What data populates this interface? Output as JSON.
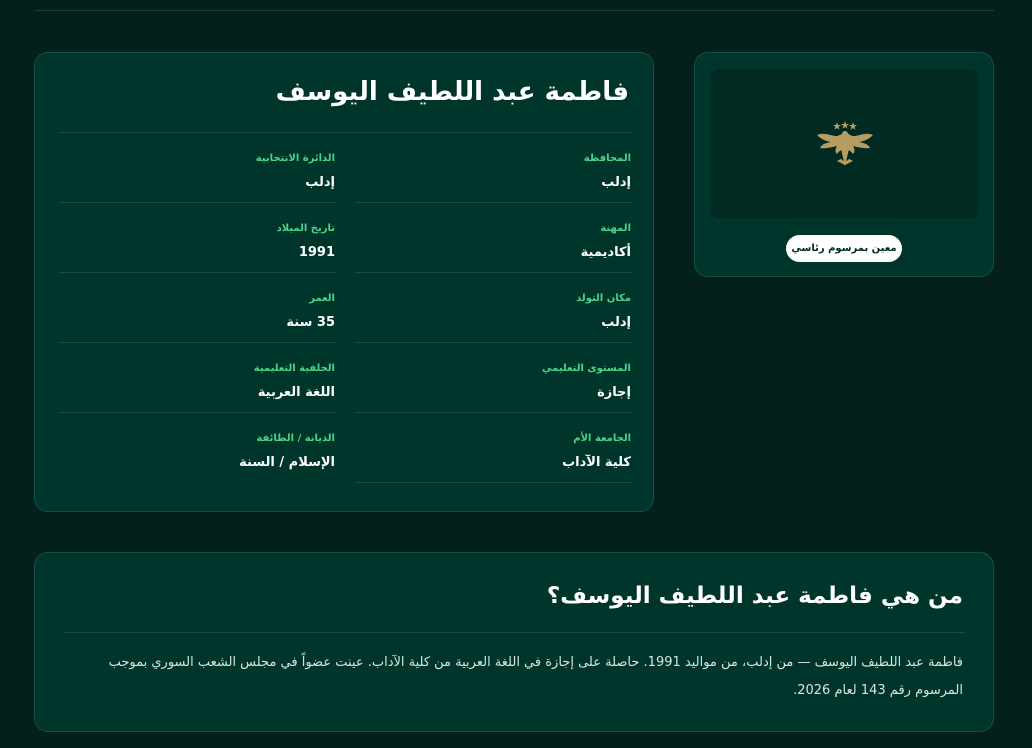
{
  "profile": {
    "name": "فاطمة عبد اللطيف اليوسف",
    "appointment_badge": "معين بمرسوم رئاسي",
    "photo_icon": "eagle-emblem-icon"
  },
  "fields": [
    {
      "label": "المحافظة",
      "value": "إدلب"
    },
    {
      "label": "الدائرة الانتخابية",
      "value": "إدلب"
    },
    {
      "label": "المهنة",
      "value": "أكاديمية"
    },
    {
      "label": "تاريخ الميلاد",
      "value": "1991"
    },
    {
      "label": "مكان التولد",
      "value": "إدلب"
    },
    {
      "label": "العمر",
      "value": "35 سنة"
    },
    {
      "label": "المستوى التعليمي",
      "value": "إجازة"
    },
    {
      "label": "الخلفية التعليمية",
      "value": "اللغة العربية"
    },
    {
      "label": "الجامعة الأم",
      "value": "كلية الآداب"
    },
    {
      "label": "الديانة / الطائفة",
      "value": "الإسلام / السنة"
    }
  ],
  "bio": {
    "title": "من هي فاطمة عبد اللطيف اليوسف؟",
    "text": "فاطمة عبد اللطيف اليوسف — من إدلب، من مواليد 1991. حاصلة على إجازة في اللغة العربية من كلية الآداب. عينت عضواً في مجلس الشعب السوري بموجب المرسوم رقم 143 لعام 2026."
  },
  "colors": {
    "background": "#03201a",
    "card": "#00352c",
    "accent_label": "#4cd28a",
    "emblem_gold": "#b89d62"
  }
}
